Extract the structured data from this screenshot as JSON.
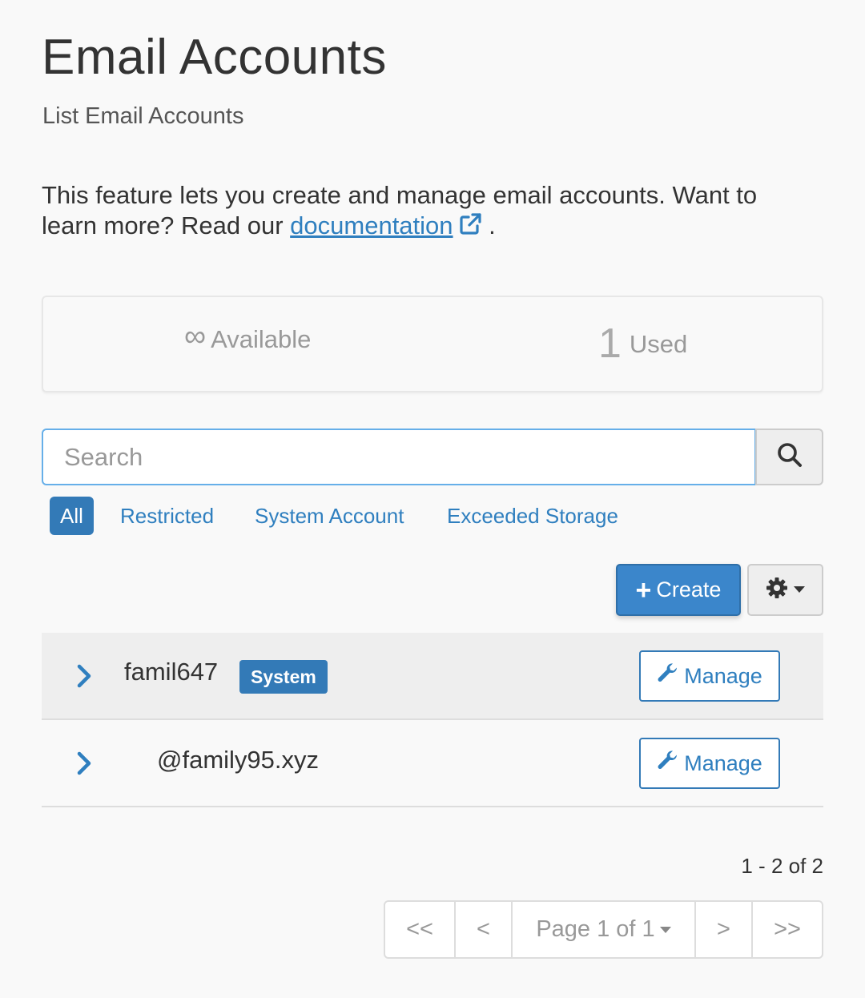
{
  "header": {
    "title": "Email Accounts",
    "subtitle": "List Email Accounts"
  },
  "intro": {
    "text_before": "This feature lets you create and manage email accounts. Want to learn more? Read our ",
    "link_text": "documentation",
    "text_after": " ."
  },
  "stats": {
    "available_symbol": "∞",
    "available_label": "Available",
    "used_value": "1",
    "used_label": "Used"
  },
  "search": {
    "placeholder": "Search",
    "value": ""
  },
  "filters": {
    "all": "All",
    "restricted": "Restricted",
    "system_account": "System Account",
    "exceeded_storage": "Exceeded Storage",
    "active": "All"
  },
  "toolbar": {
    "create_label": "Create"
  },
  "accounts": [
    {
      "name": "famil647",
      "badge": "System",
      "manage_label": "Manage"
    },
    {
      "name": "@family95.xyz",
      "manage_label": "Manage"
    }
  ],
  "pagination": {
    "summary": "1 - 2 of 2",
    "first": "<<",
    "prev": "<",
    "page_label": "Page 1 of 1",
    "next": ">",
    "last": ">>"
  },
  "colors": {
    "accent": "#337ab7",
    "link": "#2f7fbf",
    "background": "#f9f9f9"
  }
}
